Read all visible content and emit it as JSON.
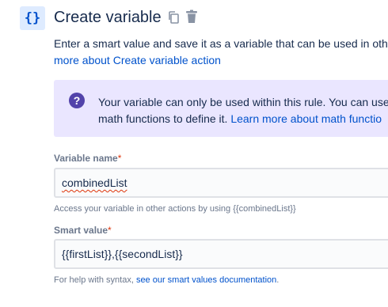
{
  "header": {
    "icon_glyph": "{}",
    "icon_name": "braces-icon",
    "title": "Create variable",
    "copy_icon": "copy-icon",
    "delete_icon": "trash-icon"
  },
  "description": {
    "line1": "Enter a smart value and save it as a variable that can be used in othe",
    "line2_link": "more about Create variable action"
  },
  "info_panel": {
    "icon_glyph": "?",
    "line1": "Your variable can only be used within this rule. You can use",
    "line2_text": "math functions to define it. ",
    "line2_link": "Learn more about math functio"
  },
  "fields": {
    "variable_name": {
      "label": "Variable name",
      "required_mark": "*",
      "value": "combinedList",
      "helper": "Access your variable in other actions by using {{combinedList}}"
    },
    "smart_value": {
      "label": "Smart value",
      "required_mark": "*",
      "value": "{{firstList}},{{secondList}}",
      "helper_text": "For help with syntax, ",
      "helper_link": "see our smart values documentation",
      "helper_end": "."
    }
  },
  "colors": {
    "accent": "#0052cc",
    "icon_bg": "#deebff",
    "info_bg": "#eae6ff",
    "info_icon": "#5243aa",
    "required": "#de350b",
    "muted": "#6b778c"
  }
}
